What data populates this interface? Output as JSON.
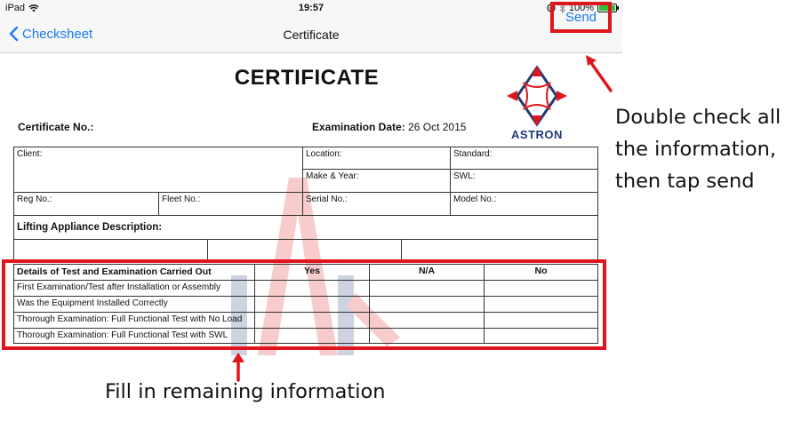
{
  "status_bar": {
    "device": "iPad",
    "time": "19:57",
    "battery": "100%",
    "battery_level": 1.0,
    "icons": [
      "wifi-icon",
      "lock-rotation-icon",
      "bluetooth-icon",
      "battery-icon"
    ]
  },
  "nav": {
    "back_label": "Checksheet",
    "title": "Certificate",
    "send_label": "Send"
  },
  "document": {
    "title": "CERTIFICATE",
    "logo_text": "ASTRON",
    "certificate_no_label": "Certificate No.:",
    "examination_date_label": "Examination Date:",
    "examination_date_value": "26 Oct 2015",
    "fields": {
      "client": "Client:",
      "location": "Location:",
      "standard": "Standard:",
      "make_year": "Make & Year:",
      "swl": "SWL:",
      "reg_no": "Reg No.:",
      "fleet_no": "Fleet No.:",
      "serial_no": "Serial No.:",
      "model_no": "Model No.:",
      "lifting_appliance": "Lifting Appliance Description:"
    },
    "details_table": {
      "headers": [
        "Details of Test and Examination Carried Out",
        "Yes",
        "N/A",
        "No"
      ],
      "rows": [
        "First Examination/Test after Installation or Assembly",
        "Was the Equipment Installed Correctly",
        "Thorough Examination: Full Functional Test with No Load",
        "Thorough Examination: Full Functional Test with SWL"
      ]
    }
  },
  "annotations": {
    "right": "Double check all the information, then tap send",
    "bottom": "Fill in remaining information"
  },
  "colors": {
    "accent": "#1a7cf2",
    "highlight": "#e0161e",
    "battery": "#2fbf3a",
    "logo_blue": "#1f3a7a",
    "logo_red": "#e0161e"
  }
}
